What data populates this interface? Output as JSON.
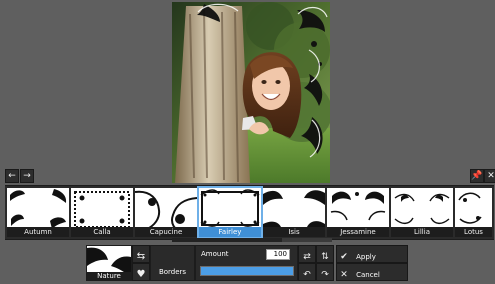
{
  "borders": [
    {
      "label": "Autumn",
      "selected": false
    },
    {
      "label": "Calla",
      "selected": false
    },
    {
      "label": "Capucine",
      "selected": false
    },
    {
      "label": "Fairley",
      "selected": true
    },
    {
      "label": "Isis",
      "selected": false
    },
    {
      "label": "Jessamine",
      "selected": false
    },
    {
      "label": "Lillia",
      "selected": false
    },
    {
      "label": "Lotus",
      "selected": false
    }
  ],
  "preview": {
    "label": "Nature"
  },
  "category": {
    "label": "Borders"
  },
  "amount": {
    "label": "Amount",
    "value": "100",
    "percent": 100
  },
  "actions": {
    "apply": "Apply",
    "cancel": "Cancel"
  },
  "colors": {
    "background": "#5f5f5f",
    "panel": "#2a2a2a",
    "accent": "#4c9ee6"
  }
}
